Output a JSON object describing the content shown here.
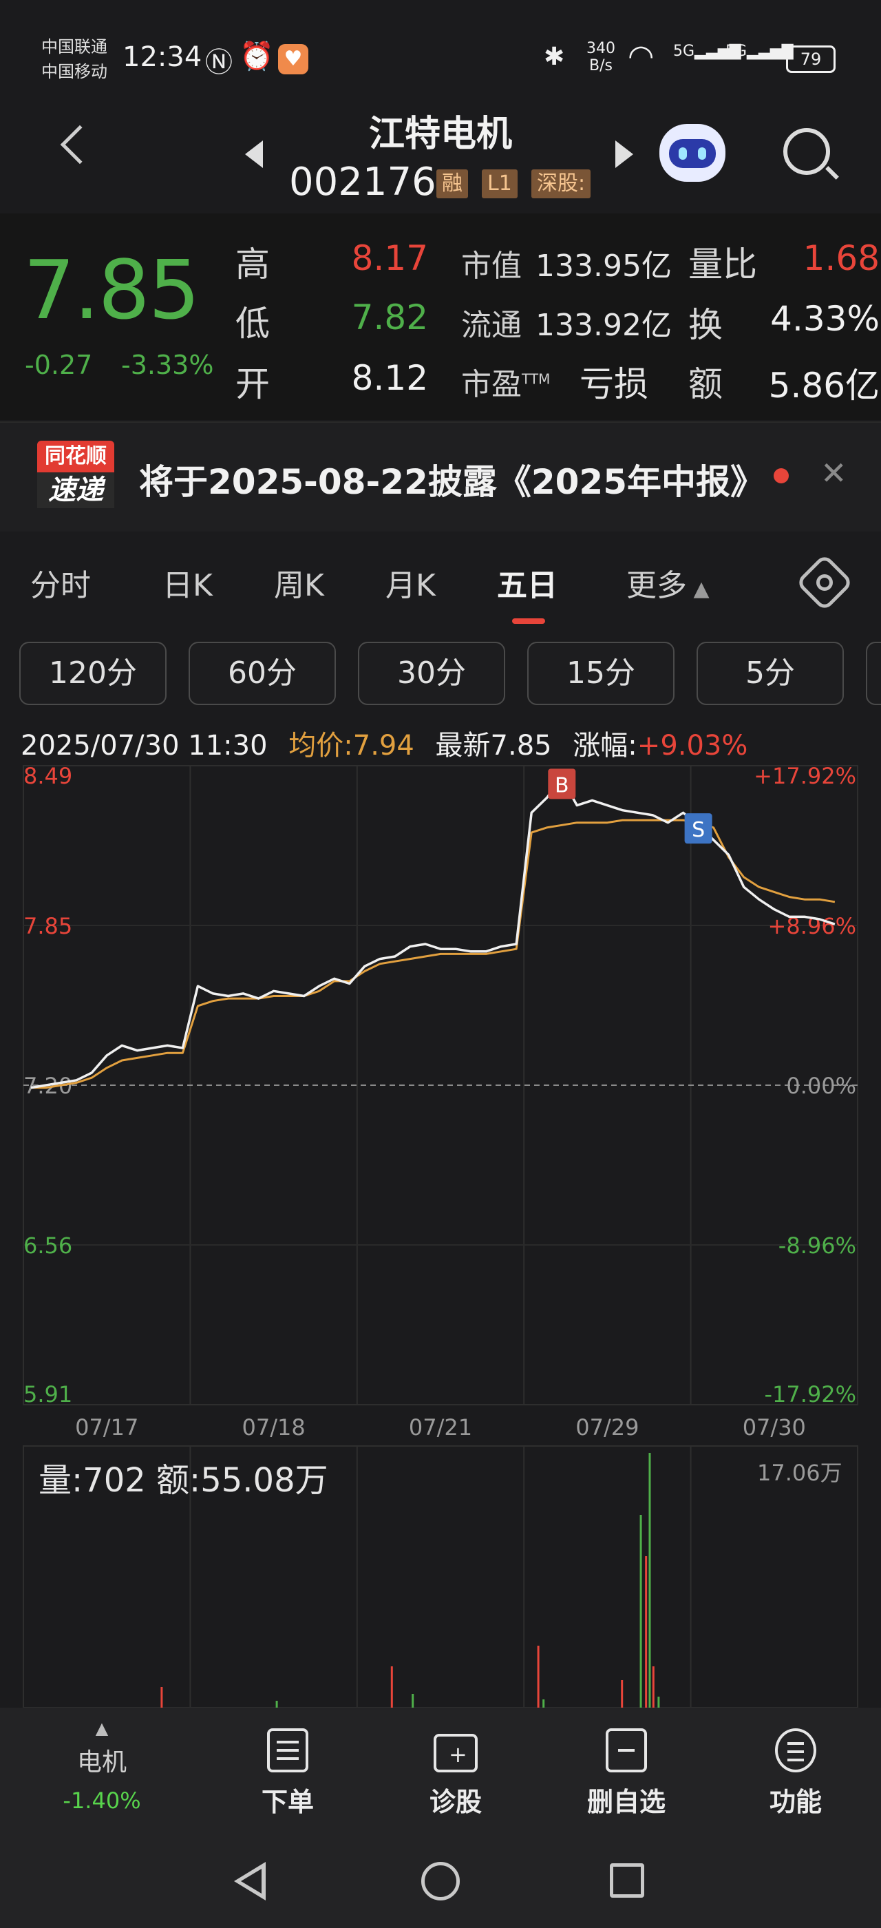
{
  "status_bar": {
    "carrier1": "中国联通",
    "carrier2": "中国移动",
    "time": "12:34",
    "net_speed_value": "340",
    "net_speed_unit": "B/s",
    "battery": "79"
  },
  "header": {
    "stock_name": "江特电机",
    "stock_code": "002176",
    "tags": [
      "融",
      "L1",
      "深股:"
    ]
  },
  "quote": {
    "price": "7.85",
    "change": "-0.27",
    "change_pct": "-3.33%",
    "high_label": "高",
    "high": "8.17",
    "low_label": "低",
    "low": "7.82",
    "open_label": "开",
    "open": "8.12",
    "mcap_label": "市值",
    "mcap": "133.95亿",
    "float_label": "流通",
    "float": "133.92亿",
    "pe_label": "市盈",
    "pe_sup": "TTM",
    "pe": "亏损",
    "vol_ratio_label": "量比",
    "vol_ratio": "1.68",
    "turnover_label": "换",
    "turnover": "4.33%",
    "amount_label": "额",
    "amount": "5.86亿"
  },
  "notice": {
    "badge_top": "同花顺",
    "badge_bottom": "速递",
    "text": "将于2025-08-22披露《2025年中报》",
    "close": "✕"
  },
  "tabs": [
    "分时",
    "日K",
    "周K",
    "月K",
    "五日",
    "更多"
  ],
  "active_tab": "五日",
  "periods": [
    "120分",
    "60分",
    "30分",
    "15分",
    "5分"
  ],
  "chart_info": {
    "datetime": "2025/07/30 11:30",
    "avg_label": "均价:7.94",
    "latest_label": "最新7.85",
    "change_label": "涨幅:",
    "change_value": "+9.03%"
  },
  "chart_data": {
    "type": "line",
    "y_left_ticks": [
      "8.49",
      "7.85",
      "7.20",
      "6.56",
      "5.91"
    ],
    "y_right_ticks": [
      "+17.92%",
      "+8.96%",
      "0.00%",
      "-8.96%",
      "-17.92%"
    ],
    "x_ticks": [
      "07/17",
      "07/18",
      "07/21",
      "07/29",
      "07/30"
    ],
    "ylim": [
      5.91,
      8.49
    ],
    "baseline": 7.2,
    "series": [
      {
        "name": "最新",
        "color": "#f0f0f0",
        "values": [
          7.19,
          7.2,
          7.21,
          7.22,
          7.25,
          7.32,
          7.36,
          7.34,
          7.35,
          7.36,
          7.35,
          7.6,
          7.57,
          7.56,
          7.57,
          7.55,
          7.58,
          7.57,
          7.56,
          7.6,
          7.63,
          7.61,
          7.68,
          7.71,
          7.72,
          7.76,
          7.77,
          7.75,
          7.75,
          7.74,
          7.74,
          7.76,
          7.77,
          8.3,
          8.36,
          8.44,
          8.33,
          8.35,
          8.33,
          8.31,
          8.3,
          8.29,
          8.26,
          8.3,
          8.25,
          8.19,
          8.13,
          8.0,
          7.95,
          7.91,
          7.88,
          7.88,
          7.87,
          7.85
        ]
      },
      {
        "name": "均价",
        "color": "#e2a03f",
        "values": [
          7.19,
          7.19,
          7.2,
          7.21,
          7.23,
          7.27,
          7.3,
          7.31,
          7.32,
          7.33,
          7.33,
          7.52,
          7.54,
          7.55,
          7.55,
          7.55,
          7.56,
          7.56,
          7.56,
          7.58,
          7.62,
          7.62,
          7.66,
          7.69,
          7.7,
          7.71,
          7.72,
          7.73,
          7.73,
          7.73,
          7.73,
          7.74,
          7.75,
          8.22,
          8.24,
          8.25,
          8.26,
          8.26,
          8.26,
          8.27,
          8.27,
          8.27,
          8.27,
          8.27,
          8.26,
          8.24,
          8.12,
          8.04,
          8.0,
          7.98,
          7.96,
          7.95,
          7.95,
          7.94
        ]
      }
    ],
    "markers": [
      {
        "label": "B",
        "index": 35,
        "price": 8.4,
        "color": "#c9463d"
      },
      {
        "label": "S",
        "index": 44,
        "price": 8.22,
        "color": "#3d74c4"
      }
    ]
  },
  "volume": {
    "label": "量:702  额:55.08万",
    "max_label": "17.06万"
  },
  "bottom_bar": {
    "sector_name": "电机",
    "sector_change": "-1.40%",
    "items": [
      "下单",
      "诊股",
      "删自选",
      "功能"
    ]
  }
}
